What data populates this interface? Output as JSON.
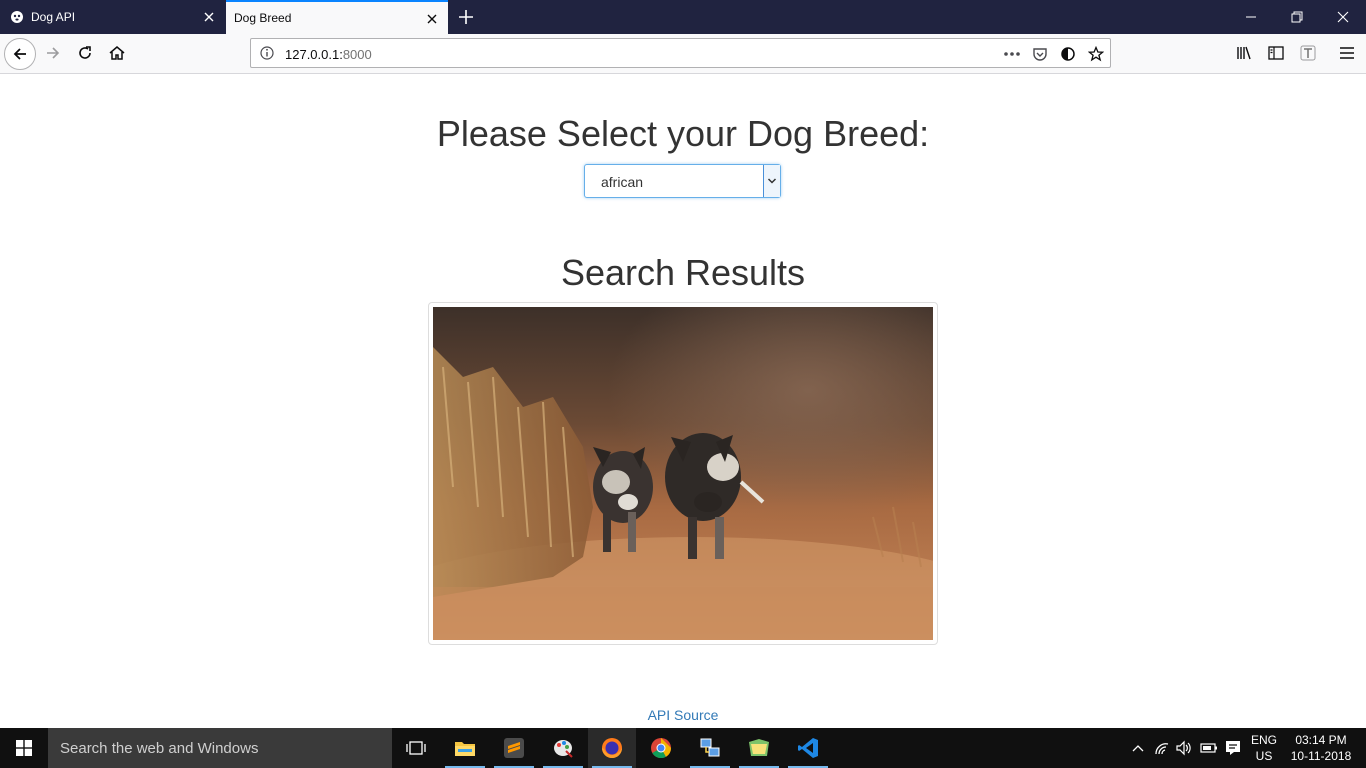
{
  "browser": {
    "tabs": [
      {
        "title": "Dog API",
        "active": false
      },
      {
        "title": "Dog Breed",
        "active": true
      }
    ],
    "url_host": "127.0.0.1:",
    "url_port": "8000"
  },
  "page": {
    "select_heading": "Please Select your Dog Breed:",
    "breed_select": {
      "selected": "african"
    },
    "results_heading": "Search Results",
    "api_link": "API Source"
  },
  "taskbar": {
    "search_placeholder": "Search the web and Windows",
    "apps": [
      "task-view",
      "file-explorer",
      "sublime-text",
      "paint",
      "firefox",
      "chrome",
      "network",
      "folder",
      "vscode"
    ],
    "language": "ENG",
    "region": "US",
    "time": "03:14 PM",
    "date": "10-11-2018"
  },
  "colors": {
    "titlebar": "#202340",
    "tab_accent": "#0a84ff",
    "link": "#337ab7",
    "heading": "#333333",
    "taskbar": "#101010"
  }
}
